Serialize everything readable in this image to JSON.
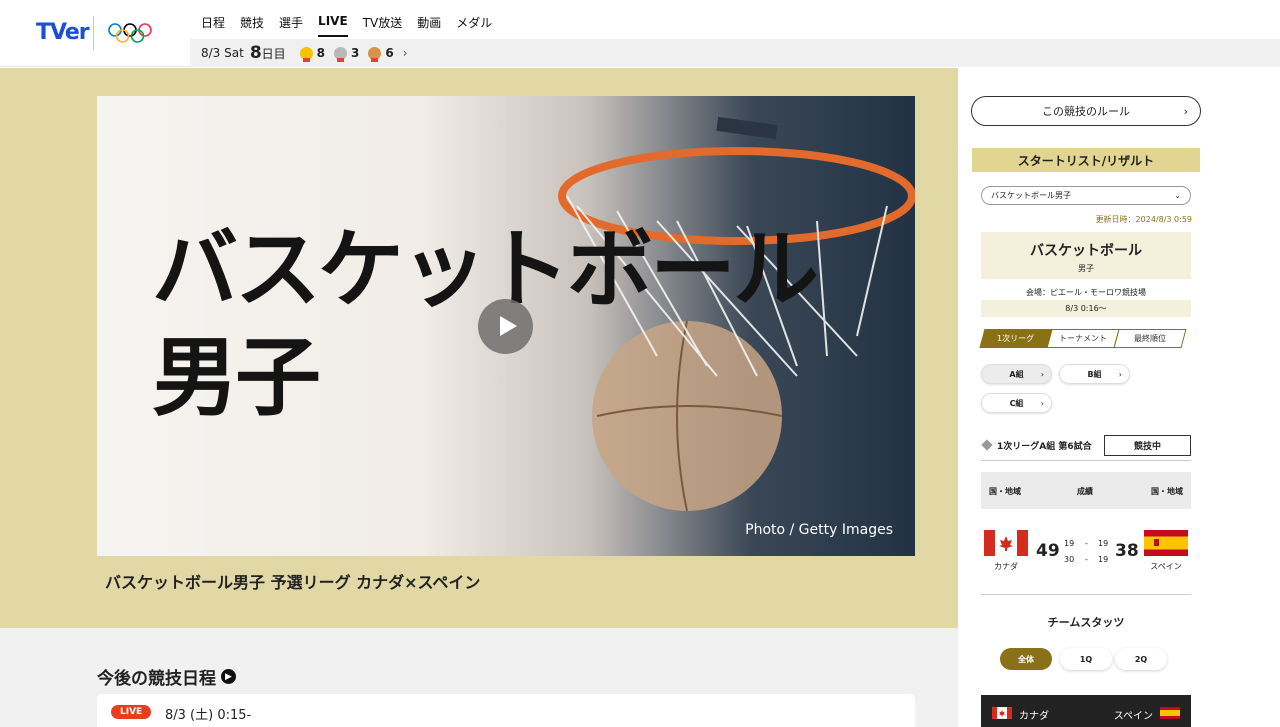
{
  "header": {
    "logo_text": "TVer",
    "nav": [
      "日程",
      "競技",
      "選手",
      "LIVE",
      "TV放送",
      "動画",
      "メダル"
    ],
    "active_nav": "LIVE"
  },
  "subbar": {
    "date": "8/3 Sat",
    "day_num": "8",
    "day_unit": "日目",
    "gold": "8",
    "silver": "3",
    "bronze": "6"
  },
  "hero": {
    "title_line1": "バスケットボール",
    "title_line2": "男子",
    "photo_credit": "Photo / Getty Images",
    "caption": "バスケットボール男子 予選リーグ カナダ×スペイン"
  },
  "upcoming": {
    "title": "今後の競技日程",
    "live_badge": "LIVE",
    "time": "8/3 (土) 0:15-"
  },
  "panel": {
    "rules_button": "この競技のルール",
    "section_title": "スタートリスト/リザルト",
    "select_value": "バスケットボール男子",
    "updated": "更新日時：2024/8/3 0:59",
    "event_name": "バスケットボール",
    "event_sub": "男子",
    "venue": "会場：ピエール・モーロワ競技場",
    "venue_time": "8/3 0:16〜",
    "stage_tabs": [
      "1次リーグ",
      "トーナメント",
      "最終順位"
    ],
    "groups": [
      "A組",
      "B組",
      "C組"
    ],
    "match_label": "1次リーグA組 第6試合",
    "match_status": "競技中",
    "score_headers": [
      "国・地域",
      "成績",
      "国・地域"
    ],
    "team_left": {
      "name": "カナダ",
      "total": "49",
      "q1": "19",
      "q2": "30"
    },
    "team_right": {
      "name": "スペイン",
      "total": "38",
      "q1": "19",
      "q2": "19"
    },
    "team_stats_title": "チームスタッツ",
    "stat_tabs": [
      "全体",
      "1Q",
      "2Q"
    ]
  },
  "colors": {
    "gold_bg": "#e2d8a6",
    "accent": "#8a7118",
    "live_red": "#e83e1b"
  }
}
